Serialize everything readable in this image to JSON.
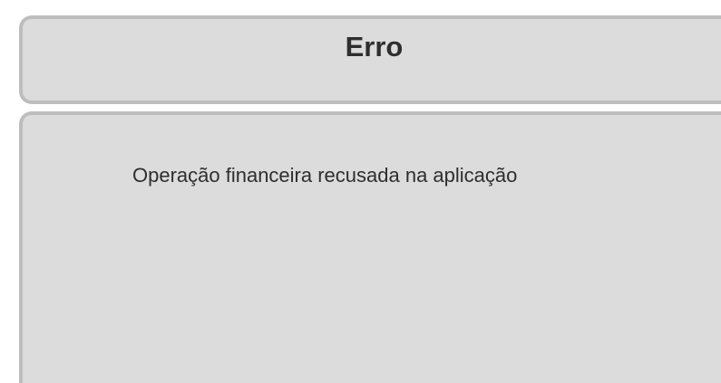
{
  "dialog": {
    "title": "Erro",
    "message": "Operação financeira recusada na aplicação"
  },
  "colors": {
    "panel_background": "#dcdcdc",
    "panel_border": "#bdbdbd",
    "text": "#2e2e2e"
  }
}
